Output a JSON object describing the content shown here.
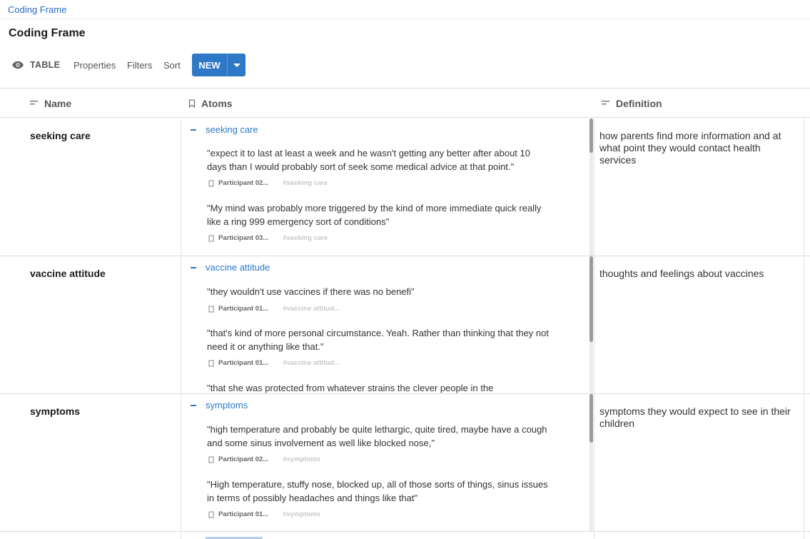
{
  "breadcrumb": "Coding Frame",
  "page_title": "Coding Frame",
  "toolbar": {
    "view_label": "TABLE",
    "properties": "Properties",
    "filters": "Filters",
    "sort": "Sort",
    "new_label": "NEW"
  },
  "columns": {
    "name": "Name",
    "atoms": "Atoms",
    "definition": "Definition"
  },
  "rows": [
    {
      "name": "seeking care",
      "tag": "seeking care",
      "definition": "how parents find more information and at what point they would contact health services",
      "quotes": [
        {
          "text": "\"expect it to last at least a week and he wasn't getting any better after about 10 days than I would probably sort of seek some medical advice at that point.\"",
          "participant": "Participant 02...",
          "tag": "#seeking care"
        },
        {
          "text": "\"My mind was probably more triggered by the kind of more immediate quick really like a ring 999 emergency sort of conditions\"",
          "participant": "Participant 03...",
          "tag": "#seeking care"
        }
      ]
    },
    {
      "name": "vaccine attitude",
      "tag": "vaccine attitude",
      "definition": "thoughts and feelings about vaccines",
      "quotes": [
        {
          "text": "\"they wouldn't use vaccines if there was no benefi\"",
          "participant": "Participant 01...",
          "tag": "#vaccine attitud..."
        },
        {
          "text": "\"that's kind of more personal circumstance. Yeah. Rather than thinking that they not need it or anything like that.\"",
          "participant": "Participant 01...",
          "tag": "#vaccine attitud..."
        },
        {
          "text": "\"that she was protected from whatever strains the clever people in the",
          "participant": "",
          "tag": ""
        }
      ]
    },
    {
      "name": "symptoms",
      "tag": "symptoms",
      "definition": "symptoms they would expect to see in their children",
      "quotes": [
        {
          "text": "\"high temperature and probably be quite lethargic, quite tired, maybe have a cough and some sinus involvement as well like blocked nose,\"",
          "participant": "Participant 02...",
          "tag": "#symptoms"
        },
        {
          "text": "\"High temperature, stuffy nose, blocked up, all of those sorts of things, sinus issues in terms of possibly headaches and things like that\"",
          "participant": "Participant 01...",
          "tag": "#symptoms"
        }
      ]
    }
  ],
  "colors": {
    "accent": "#2e78c8",
    "link": "#2b6cc4",
    "tag_chip": "#c8c8c8"
  }
}
